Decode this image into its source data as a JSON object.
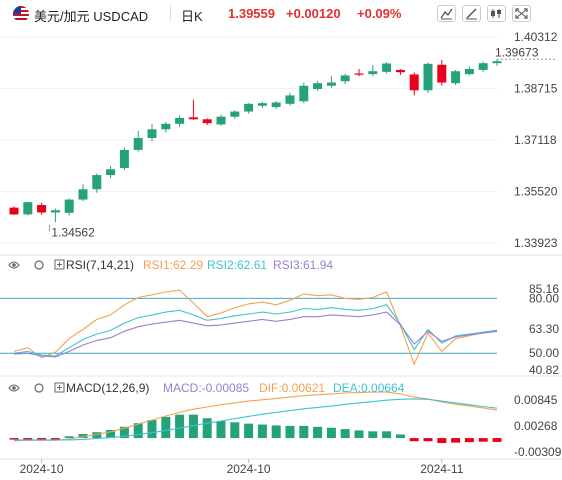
{
  "header": {
    "pair_label": "美元/加元",
    "symbol": "USDCAD",
    "period": "日K",
    "price": "1.39559",
    "change": "+0.00120",
    "change_pct": "+0.09%"
  },
  "colors": {
    "up": "#26a27a",
    "down": "#e8001c",
    "rsi1": "#f2a252",
    "rsi2": "#3fc4d4",
    "rsi3": "#9a7fd1",
    "dif": "#f2a252",
    "dea": "#3fc4d4",
    "macd_text": "#9a7fd1"
  },
  "icons": [
    "flag-icon",
    "chart-type-icon",
    "draw-icon",
    "settings-icon",
    "expand-icon"
  ],
  "chart_data": [
    {
      "type": "candlestick",
      "name": "price",
      "y_ticks": [
        "1.40312",
        "1.38715",
        "1.37118",
        "1.35520",
        "1.33923"
      ],
      "ylim": [
        1.33923,
        1.40312
      ],
      "annotations": [
        {
          "label": "1.39673"
        },
        {
          "label": "1.34562"
        }
      ],
      "candles": [
        {
          "o": 1.3502,
          "h": 1.3506,
          "l": 1.3479,
          "c": 1.3481
        },
        {
          "o": 1.3481,
          "h": 1.3521,
          "l": 1.3478,
          "c": 1.3519
        },
        {
          "o": 1.351,
          "h": 1.3517,
          "l": 1.348,
          "c": 1.3487
        },
        {
          "o": 1.3487,
          "h": 1.3499,
          "l": 1.3456,
          "c": 1.3494
        },
        {
          "o": 1.3486,
          "h": 1.353,
          "l": 1.3478,
          "c": 1.3527
        },
        {
          "o": 1.3527,
          "h": 1.3574,
          "l": 1.3522,
          "c": 1.3559
        },
        {
          "o": 1.3559,
          "h": 1.3608,
          "l": 1.3548,
          "c": 1.3603
        },
        {
          "o": 1.3603,
          "h": 1.3632,
          "l": 1.3593,
          "c": 1.3621
        },
        {
          "o": 1.3625,
          "h": 1.3688,
          "l": 1.3618,
          "c": 1.3681
        },
        {
          "o": 1.3681,
          "h": 1.374,
          "l": 1.3676,
          "c": 1.3718
        },
        {
          "o": 1.3718,
          "h": 1.3761,
          "l": 1.3708,
          "c": 1.3745
        },
        {
          "o": 1.3745,
          "h": 1.3768,
          "l": 1.3735,
          "c": 1.3762
        },
        {
          "o": 1.3762,
          "h": 1.3788,
          "l": 1.3752,
          "c": 1.378
        },
        {
          "o": 1.3782,
          "h": 1.3837,
          "l": 1.3774,
          "c": 1.3776
        },
        {
          "o": 1.3776,
          "h": 1.3779,
          "l": 1.3758,
          "c": 1.3764
        },
        {
          "o": 1.376,
          "h": 1.379,
          "l": 1.3756,
          "c": 1.3784
        },
        {
          "o": 1.3784,
          "h": 1.3804,
          "l": 1.3778,
          "c": 1.38
        },
        {
          "o": 1.38,
          "h": 1.3826,
          "l": 1.3794,
          "c": 1.3824
        },
        {
          "o": 1.3818,
          "h": 1.383,
          "l": 1.3811,
          "c": 1.3826
        },
        {
          "o": 1.3814,
          "h": 1.3832,
          "l": 1.3808,
          "c": 1.3828
        },
        {
          "o": 1.3824,
          "h": 1.3858,
          "l": 1.3818,
          "c": 1.385
        },
        {
          "o": 1.3832,
          "h": 1.389,
          "l": 1.3826,
          "c": 1.388
        },
        {
          "o": 1.387,
          "h": 1.3895,
          "l": 1.3864,
          "c": 1.3888
        },
        {
          "o": 1.388,
          "h": 1.391,
          "l": 1.3874,
          "c": 1.389
        },
        {
          "o": 1.3894,
          "h": 1.3917,
          "l": 1.3885,
          "c": 1.3912
        },
        {
          "o": 1.3918,
          "h": 1.3932,
          "l": 1.391,
          "c": 1.3916
        },
        {
          "o": 1.3916,
          "h": 1.3944,
          "l": 1.391,
          "c": 1.3925
        },
        {
          "o": 1.3923,
          "h": 1.3954,
          "l": 1.3918,
          "c": 1.3949
        },
        {
          "o": 1.3929,
          "h": 1.3932,
          "l": 1.3913,
          "c": 1.3922
        },
        {
          "o": 1.3915,
          "h": 1.3921,
          "l": 1.385,
          "c": 1.3866
        },
        {
          "o": 1.3866,
          "h": 1.3952,
          "l": 1.3858,
          "c": 1.3948
        },
        {
          "o": 1.3945,
          "h": 1.396,
          "l": 1.388,
          "c": 1.389
        },
        {
          "o": 1.3888,
          "h": 1.3929,
          "l": 1.3882,
          "c": 1.3925
        },
        {
          "o": 1.3916,
          "h": 1.394,
          "l": 1.3912,
          "c": 1.3932
        },
        {
          "o": 1.3929,
          "h": 1.3955,
          "l": 1.3923,
          "c": 1.395
        },
        {
          "o": 1.395,
          "h": 1.3962,
          "l": 1.3942,
          "c": 1.3956
        }
      ]
    },
    {
      "type": "line",
      "name": "RSI",
      "header": "RSI(7,14,21)",
      "labels": {
        "rsi1": "RSI1:62.29",
        "rsi2": "RSI2:62.61",
        "rsi3": "RSI3:61.94"
      },
      "y_ticks": [
        "85.16",
        "80.00",
        "63.30",
        "50.00",
        "40.82"
      ],
      "ylim": [
        40.82,
        85.16
      ],
      "reference_lines": [
        80,
        50
      ],
      "series": [
        {
          "key": "rsi1",
          "values": [
            51.0,
            53.0,
            47.5,
            50.5,
            58.0,
            63.0,
            68.5,
            71.0,
            76.5,
            80.5,
            82.0,
            83.5,
            84.5,
            77.5,
            70.0,
            72.0,
            75.0,
            77.0,
            78.0,
            76.5,
            79.0,
            82.5,
            81.5,
            82.0,
            80.0,
            79.5,
            80.5,
            83.5,
            65.0,
            44.0,
            61.0,
            51.0,
            58.0,
            59.5,
            61.5,
            62.29
          ]
        },
        {
          "key": "rsi2",
          "values": [
            50.0,
            51.0,
            49.0,
            48.5,
            53.0,
            57.5,
            60.5,
            62.5,
            66.5,
            69.5,
            71.0,
            72.5,
            73.5,
            71.0,
            68.0,
            69.0,
            70.5,
            71.5,
            72.5,
            71.5,
            72.5,
            74.5,
            74.0,
            75.0,
            74.0,
            73.5,
            74.5,
            76.5,
            66.0,
            52.0,
            63.0,
            55.5,
            59.5,
            60.5,
            61.5,
            62.61
          ]
        },
        {
          "key": "rsi3",
          "values": [
            49.5,
            50.0,
            48.5,
            48.0,
            51.0,
            54.5,
            57.0,
            58.5,
            62.0,
            64.5,
            66.0,
            67.0,
            68.0,
            66.5,
            65.0,
            65.5,
            66.5,
            67.5,
            68.5,
            67.5,
            68.5,
            70.0,
            70.0,
            71.0,
            70.5,
            70.0,
            71.0,
            72.5,
            65.5,
            55.0,
            62.0,
            56.5,
            59.0,
            60.0,
            61.0,
            61.94
          ]
        }
      ]
    },
    {
      "type": "bar+line",
      "name": "MACD",
      "header": "MACD(12,26,9)",
      "labels": {
        "macd": "MACD:-0.00085",
        "dif": "DIF:0.00621",
        "dea": "DEA:0.00664"
      },
      "y_ticks": [
        "0.00845",
        "0.00268",
        "-0.00309"
      ],
      "ylim": [
        -0.00309,
        0.00845
      ],
      "hist": [
        -0.0003,
        -0.0003,
        -0.0003,
        -0.0002,
        0.0004,
        0.0009,
        0.0013,
        0.0018,
        0.0025,
        0.0033,
        0.004,
        0.0047,
        0.0052,
        0.0052,
        0.0044,
        0.0038,
        0.0035,
        0.0032,
        0.003,
        0.0028,
        0.0027,
        0.0027,
        0.0025,
        0.0023,
        0.002,
        0.0017,
        0.0015,
        0.0015,
        0.0008,
        -0.0007,
        -0.0007,
        -0.0011,
        -0.001,
        -0.0009,
        -0.0008,
        -0.00085
      ],
      "dif": [
        -0.0006,
        -0.0005,
        -0.0005,
        -0.0005,
        -0.0002,
        0.0003,
        0.0008,
        0.0014,
        0.0022,
        0.0031,
        0.004,
        0.0049,
        0.0057,
        0.0064,
        0.0069,
        0.0074,
        0.0078,
        0.0082,
        0.0085,
        0.0088,
        0.0091,
        0.0094,
        0.0096,
        0.0098,
        0.01,
        0.0101,
        0.0102,
        0.0102,
        0.0098,
        0.0091,
        0.0087,
        0.008,
        0.0075,
        0.0071,
        0.0067,
        0.00621
      ],
      "dea": [
        -0.0004,
        -0.0004,
        -0.0004,
        -0.0004,
        -0.0004,
        -0.0003,
        -0.0001,
        0.0001,
        0.0004,
        0.0008,
        0.0012,
        0.0017,
        0.0022,
        0.0028,
        0.0033,
        0.0038,
        0.0043,
        0.0048,
        0.0053,
        0.0057,
        0.0061,
        0.0065,
        0.0068,
        0.0071,
        0.0075,
        0.0078,
        0.0081,
        0.0084,
        0.0086,
        0.0087,
        0.0086,
        0.0082,
        0.0078,
        0.0074,
        0.007,
        0.00664
      ]
    }
  ],
  "x_ticks": [
    "2024-10",
    "2024-10",
    "2024-11"
  ]
}
